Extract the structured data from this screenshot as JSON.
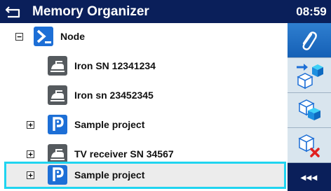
{
  "header": {
    "title": "Memory Organizer",
    "time": "08:59"
  },
  "tree": {
    "items": [
      {
        "label": "Node",
        "icon": "node-icon",
        "expander": "−"
      },
      {
        "label": "Iron SN 12341234",
        "icon": "appliance-icon"
      },
      {
        "label": "Iron sn 23452345",
        "icon": "appliance-icon"
      },
      {
        "label": "Sample project",
        "icon": "project-icon",
        "expander": "+"
      },
      {
        "label": "TV receiver SN 34567",
        "icon": "appliance-icon",
        "expander": "+"
      },
      {
        "label": "Sample project",
        "icon": "project-icon",
        "expander": "+",
        "selected": true
      }
    ]
  },
  "sidebar": {
    "buttons": [
      {
        "icon": "paperclip-icon"
      },
      {
        "icon": "add-structure-icon"
      },
      {
        "icon": "clone-structure-icon"
      },
      {
        "icon": "delete-structure-icon"
      }
    ],
    "more_label": "◂◂◂"
  },
  "colors": {
    "header_bg": "#0a1f5a",
    "selection_border": "#20d4f0",
    "sidebar_bg": "#d9e5ee",
    "accent_blue": "#1d6fd6"
  }
}
